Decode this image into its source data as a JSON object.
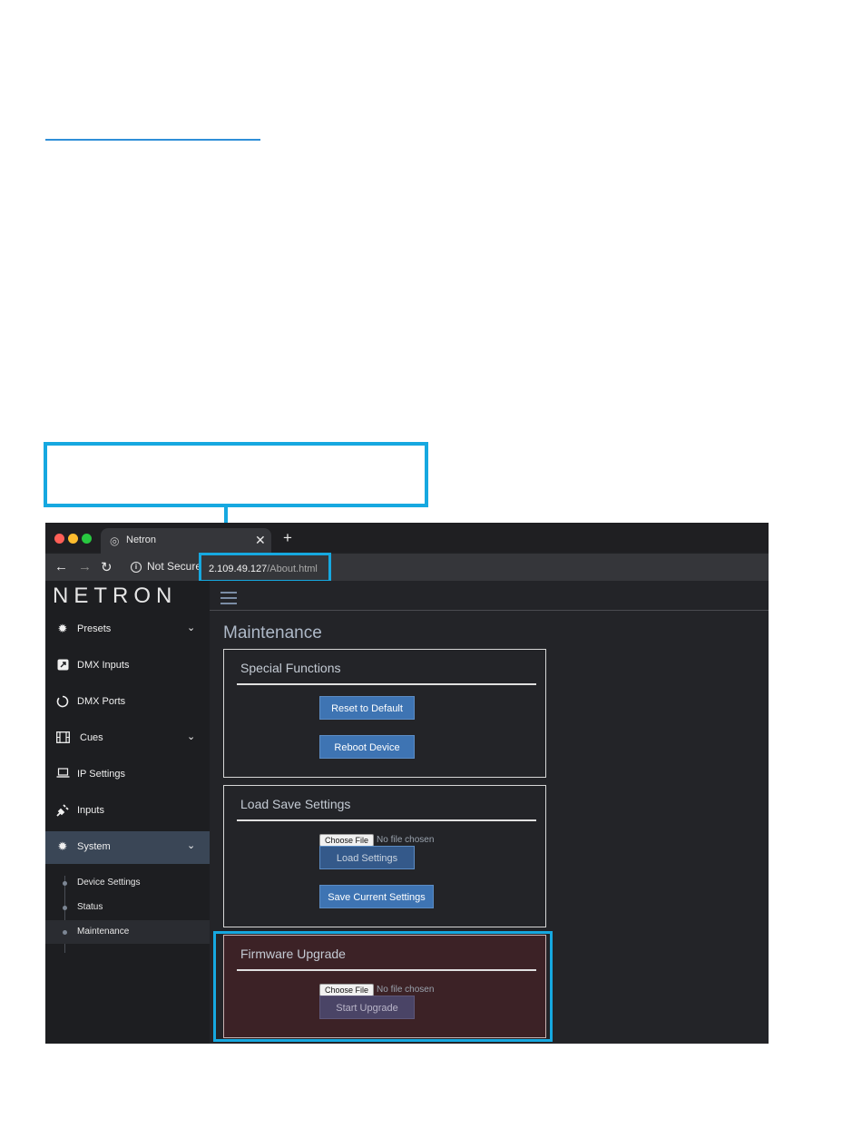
{
  "browser": {
    "tab_title": "Netron",
    "tab_close": "✕",
    "new_tab": "+",
    "security_label": "Not Secure",
    "url_host": "2.109.49.127",
    "url_path": "/About.html"
  },
  "sidebar": {
    "logo": "NETRON",
    "items": [
      {
        "label": "Presets",
        "icon": "gear-icon",
        "has_chevron": true
      },
      {
        "label": "DMX Inputs",
        "icon": "external-link-icon",
        "has_chevron": false
      },
      {
        "label": "DMX Ports",
        "icon": "circle-icon",
        "has_chevron": false
      },
      {
        "label": "Cues",
        "icon": "film-icon",
        "has_chevron": true
      },
      {
        "label": "IP Settings",
        "icon": "laptop-icon",
        "has_chevron": false
      },
      {
        "label": "Inputs",
        "icon": "plug-icon",
        "has_chevron": false
      },
      {
        "label": "System",
        "icon": "gear-icon",
        "has_chevron": true,
        "active": true
      }
    ],
    "sub_items": [
      {
        "label": "Device Settings"
      },
      {
        "label": "Status"
      },
      {
        "label": "Maintenance",
        "active": true
      }
    ]
  },
  "main": {
    "title": "Maintenance",
    "special_functions": {
      "title": "Special Functions",
      "reset_label": "Reset to Default",
      "reboot_label": "Reboot Device"
    },
    "load_save": {
      "title": "Load Save Settings",
      "choose_file": "Choose File",
      "no_file": "No file chosen",
      "load_label": "Load Settings",
      "save_label": "Save Current Settings"
    },
    "firmware": {
      "title": "Firmware Upgrade",
      "choose_file": "Choose File",
      "no_file": "No file chosen",
      "upgrade_label": "Start Upgrade"
    }
  },
  "colors": {
    "highlight": "#16a8e0",
    "accent_button": "#3e74b3",
    "firmware_panel_bg": "#3c2226"
  }
}
